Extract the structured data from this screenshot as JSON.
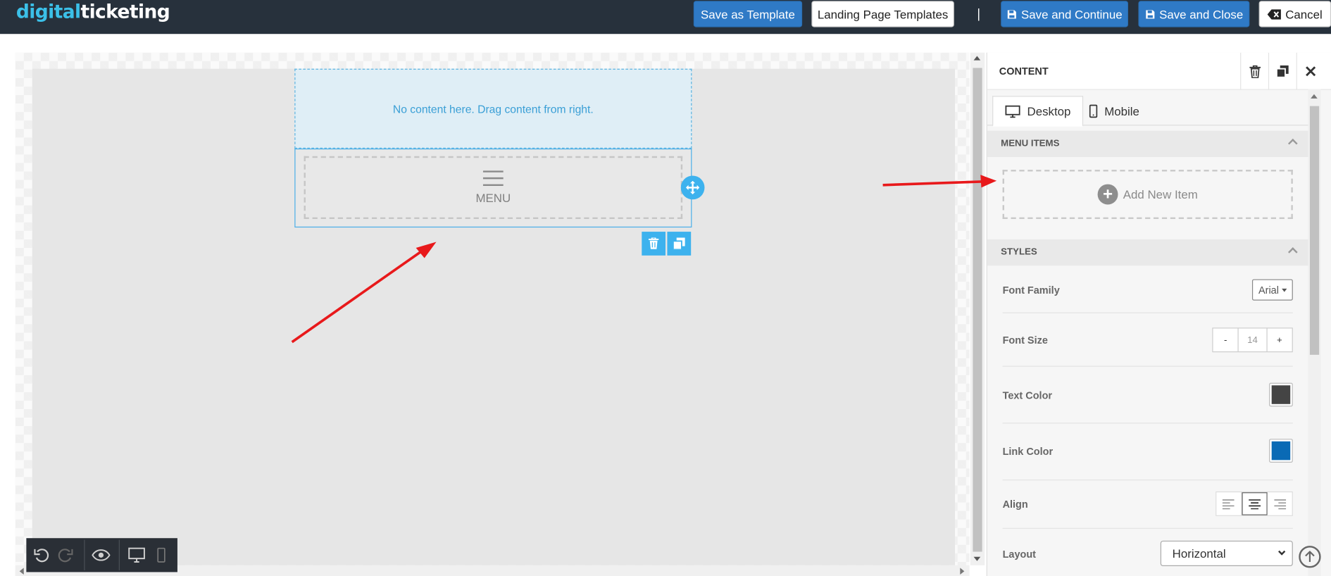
{
  "header": {
    "logo_part1": "digital",
    "logo_part2": "ticketing",
    "save_template_label": "Save as Template",
    "landing_templates_label": "Landing Page Templates",
    "separator": "|",
    "save_continue_label": "Save and Continue",
    "save_close_label": "Save and Close",
    "cancel_label": "Cancel"
  },
  "canvas": {
    "drop_zone_text": "No content here. Drag content from right.",
    "menu_block_label": "MENU"
  },
  "panel": {
    "title": "CONTENT",
    "tabs": [
      {
        "label": "Desktop",
        "icon": "desktop-icon",
        "active": true
      },
      {
        "label": "Mobile",
        "icon": "mobile-icon",
        "active": false
      }
    ],
    "menu_items_section": "MENU ITEMS",
    "add_item_label": "Add New Item",
    "styles_section": "STYLES",
    "font_family": {
      "label": "Font Family",
      "value": "Arial"
    },
    "font_size": {
      "label": "Font Size",
      "minus": "-",
      "value": "14",
      "plus": "+"
    },
    "text_color": {
      "label": "Text Color",
      "value": "#444444"
    },
    "link_color": {
      "label": "Link Color",
      "value": "#0a6ab5"
    },
    "align": {
      "label": "Align",
      "selected": "center",
      "options": [
        "left",
        "center",
        "right"
      ]
    },
    "layout": {
      "label": "Layout",
      "value": "Horizontal"
    }
  },
  "colors": {
    "topbar": "#27313c",
    "primary_button": "#2f7ac6",
    "accent": "#3db2ee",
    "annotation_arrow": "#e8191b"
  }
}
